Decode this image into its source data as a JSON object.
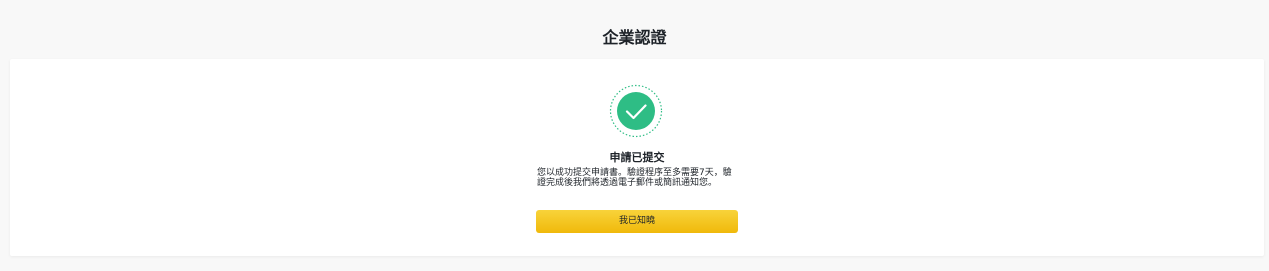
{
  "header": {
    "title": "企業認證"
  },
  "status": {
    "icon": "check-circle-icon",
    "accent_color": "#2ebd85",
    "title": "申請已提交",
    "message": "您以成功提交申請書。驗證程序至多需要7天，驗證完成後我們將透過電子郵件或簡訊通知您。"
  },
  "actions": {
    "acknowledge_label": "我已知曉",
    "button_color": "#f0b90b"
  }
}
